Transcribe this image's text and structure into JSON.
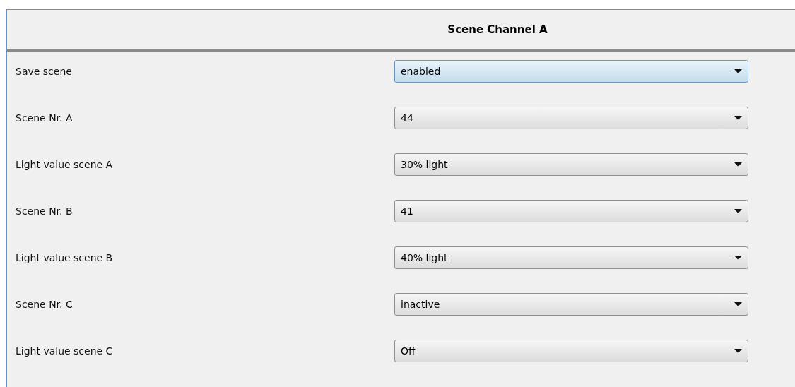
{
  "header": {
    "title": "Scene Channel A"
  },
  "rows": [
    {
      "label": "Save scene",
      "value": "enabled",
      "focused": true
    },
    {
      "label": "Scene Nr. A",
      "value": "44",
      "focused": false
    },
    {
      "label": "Light value scene A",
      "value": "30% light",
      "focused": false
    },
    {
      "label": "Scene Nr. B",
      "value": "41",
      "focused": false
    },
    {
      "label": "Light value scene B",
      "value": "40% light",
      "focused": false
    },
    {
      "label": "Scene Nr. C",
      "value": "inactive",
      "focused": false
    },
    {
      "label": "Light value scene C",
      "value": "Off",
      "focused": false
    }
  ]
}
